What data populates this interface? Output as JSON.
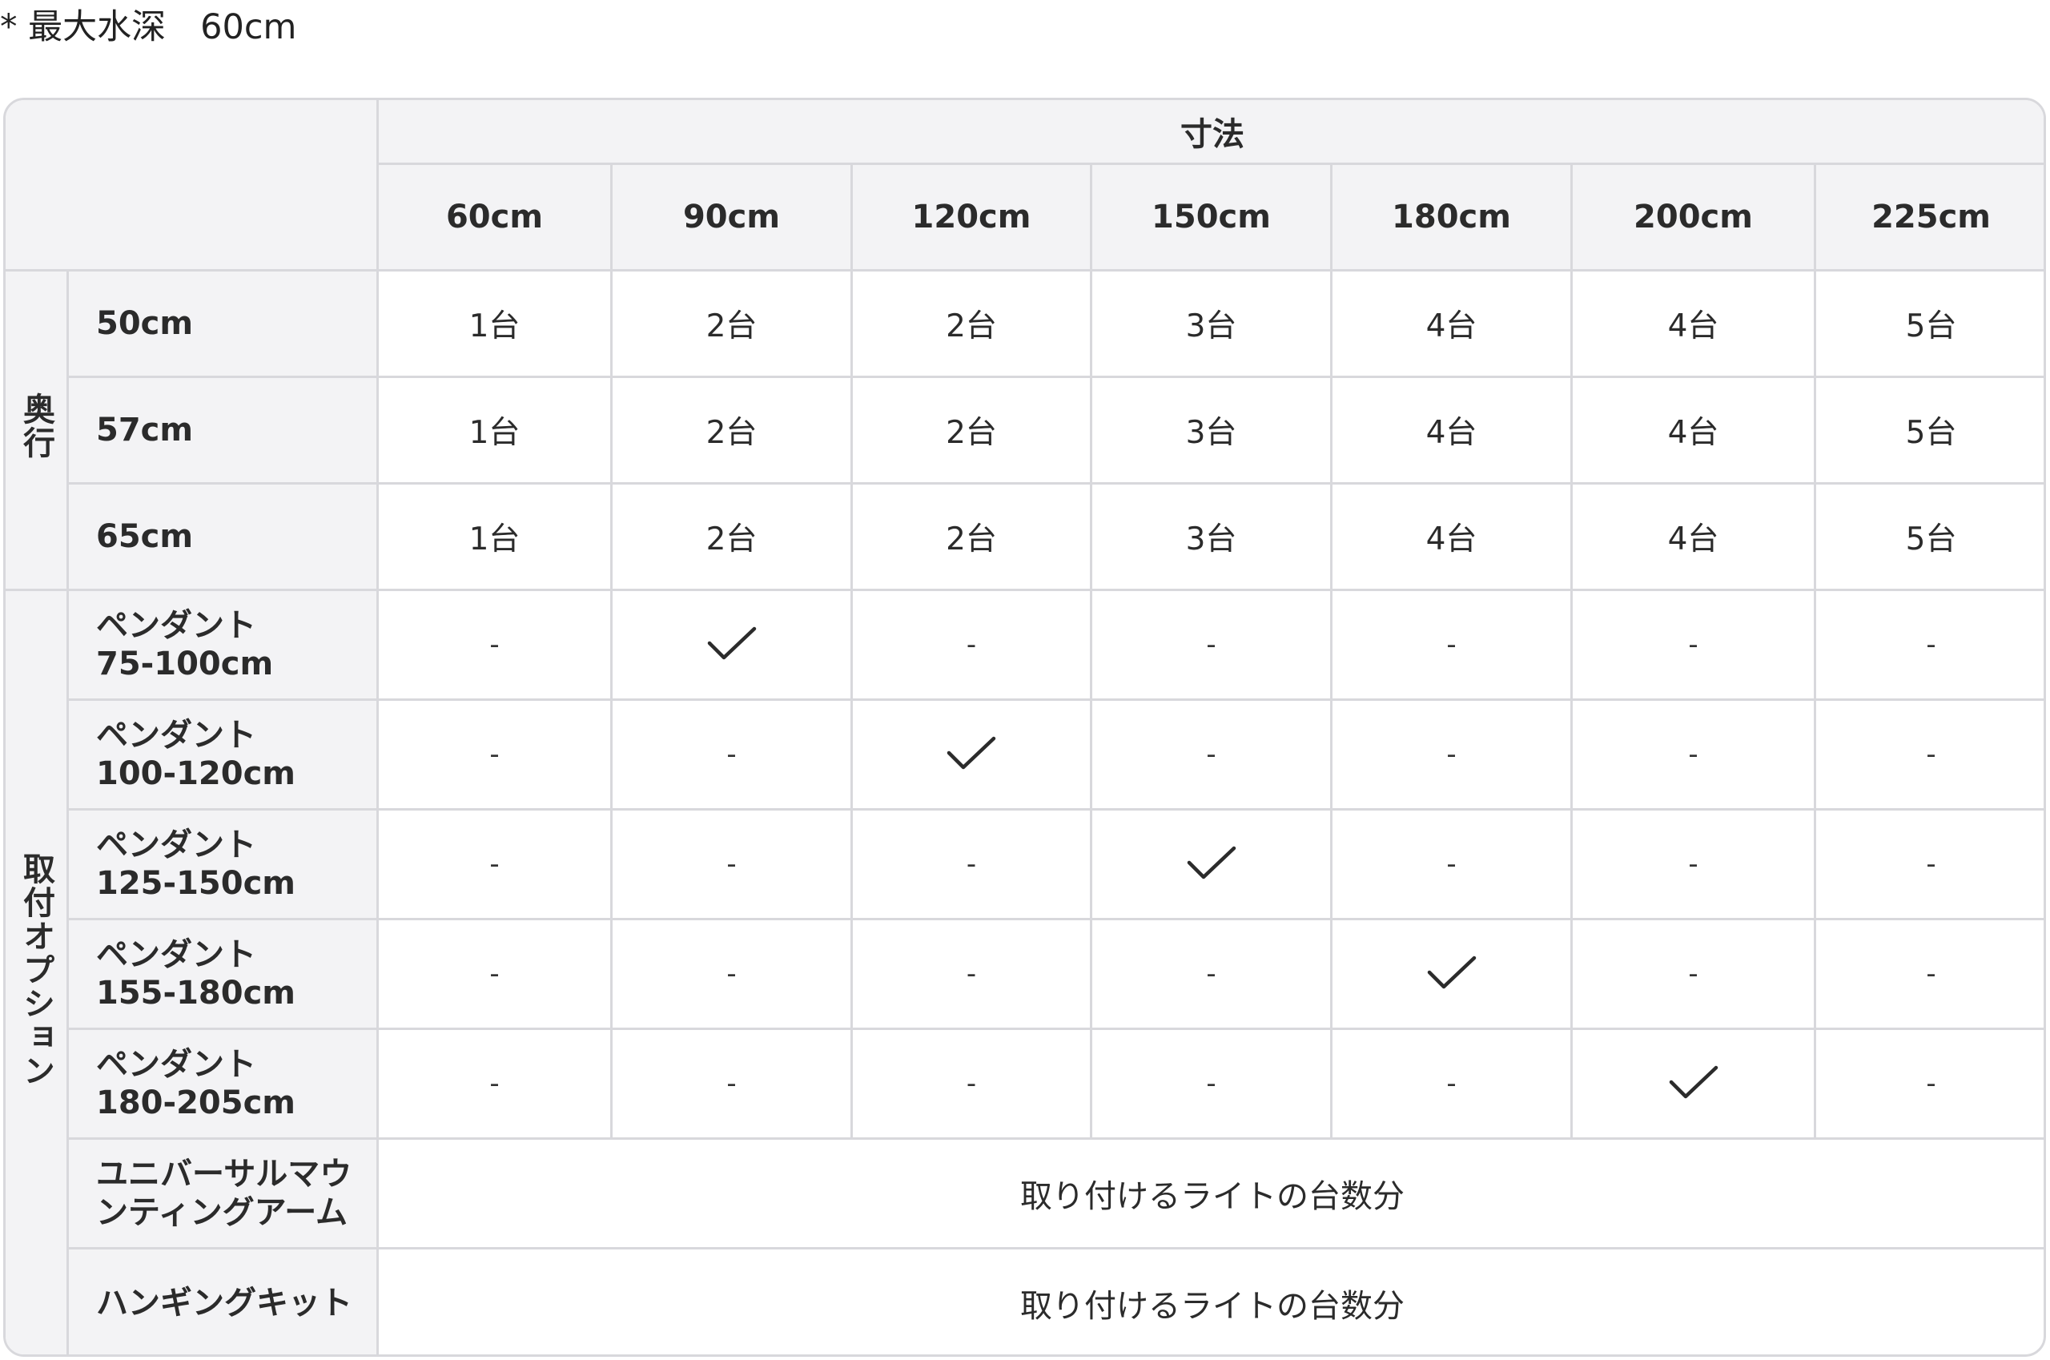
{
  "note": "* 最大水深　60cm",
  "header_title": "寸法",
  "sizes": [
    "60cm",
    "90cm",
    "120cm",
    "150cm",
    "180cm",
    "200cm",
    "225cm"
  ],
  "groups": {
    "depth": "奥行",
    "options": "取付オプション"
  },
  "depth_rows": [
    {
      "label": "50cm",
      "values": [
        "1台",
        "2台",
        "2台",
        "3台",
        "4台",
        "4台",
        "5台"
      ]
    },
    {
      "label": "57cm",
      "values": [
        "1台",
        "2台",
        "2台",
        "3台",
        "4台",
        "4台",
        "5台"
      ]
    },
    {
      "label": "65cm",
      "values": [
        "1台",
        "2台",
        "2台",
        "3台",
        "4台",
        "4台",
        "5台"
      ]
    }
  ],
  "option_rows": [
    {
      "label1": "ペンダント",
      "label2": "75-100cm",
      "checked_index": 1
    },
    {
      "label1": "ペンダント",
      "label2": "100-120cm",
      "checked_index": 2
    },
    {
      "label1": "ペンダント",
      "label2": "125-150cm",
      "checked_index": 3
    },
    {
      "label1": "ペンダント",
      "label2": "155-180cm",
      "checked_index": 4
    },
    {
      "label1": "ペンダント",
      "label2": "180-205cm",
      "checked_index": 5
    }
  ],
  "dash": "-",
  "full_rows": [
    {
      "label1": "ユニバーサルマウ",
      "label2": "ンティングアーム",
      "value": "取り付けるライトの台数分"
    },
    {
      "label1": "ハンギングキット",
      "label2": "",
      "value": "取り付けるライトの台数分"
    }
  ],
  "check_icon": "checkmark-icon"
}
